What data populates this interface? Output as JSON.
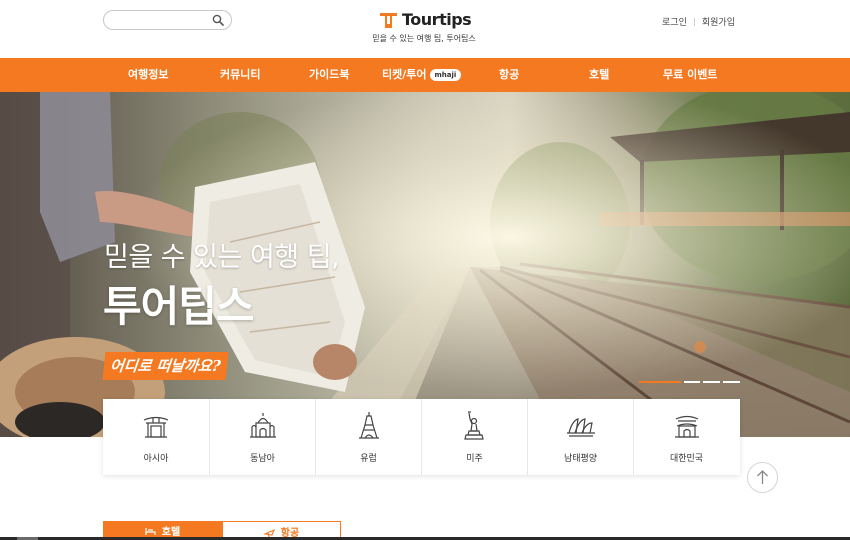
{
  "header": {
    "search": {
      "value": "",
      "placeholder": "",
      "icon": "search-icon"
    },
    "logo": {
      "text": "Tourtips",
      "icon": "tourtips-logo-icon"
    },
    "tagline": "믿을 수 있는 여행 팁, 투어팁스",
    "login": "로그인",
    "signup": "회원가입"
  },
  "nav": {
    "items": [
      {
        "label": "여행정보"
      },
      {
        "label": "커뮤니티"
      },
      {
        "label": "가이드북"
      },
      {
        "label": "티켓/투어",
        "badge": "mhaji"
      },
      {
        "label": "항공"
      },
      {
        "label": "호텔"
      },
      {
        "label": "무료 이벤트"
      }
    ]
  },
  "hero": {
    "line1": "믿을 수 있는 여행 팁,",
    "line2": "투어팁스",
    "cta": "어디로 떠날까요?",
    "slides": 4,
    "active_slide": 1
  },
  "regions": [
    {
      "label": "아시아",
      "icon": "asia-gate-icon"
    },
    {
      "label": "동남아",
      "icon": "southeast-asia-temple-icon"
    },
    {
      "label": "유럽",
      "icon": "eiffel-tower-icon"
    },
    {
      "label": "미주",
      "icon": "statue-of-liberty-icon"
    },
    {
      "label": "남태평양",
      "icon": "sydney-opera-house-icon"
    },
    {
      "label": "대한민국",
      "icon": "korea-gate-icon"
    }
  ],
  "tabs": [
    {
      "label": "호텔",
      "icon": "hotel-icon",
      "active": true
    },
    {
      "label": "항공",
      "icon": "airplane-icon",
      "active": false
    }
  ],
  "colors": {
    "accent": "#f47920",
    "text": "#333333",
    "white": "#ffffff"
  }
}
